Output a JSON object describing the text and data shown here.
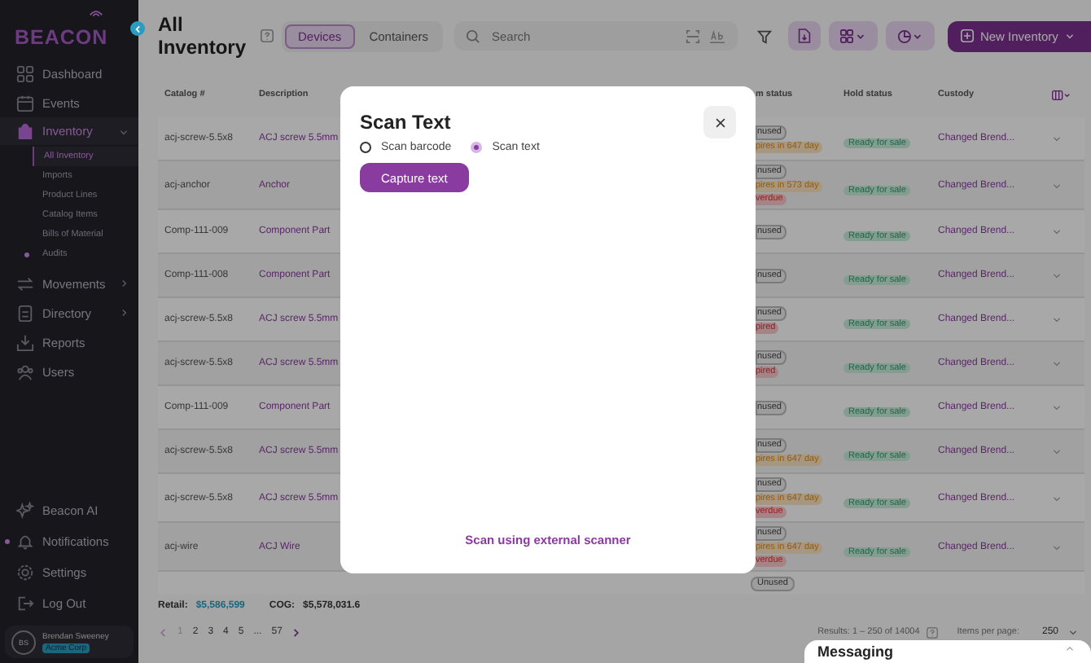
{
  "sidebar": {
    "logo": "BEACON",
    "nav": [
      {
        "label": "Dashboard",
        "kind": "link",
        "selected": false
      },
      {
        "label": "Events",
        "kind": "link",
        "selected": false
      },
      {
        "label": "Inventory",
        "kind": "group",
        "selected": true,
        "expanded": true,
        "children": [
          {
            "label": "All Inventory",
            "selected": true,
            "dot": false
          },
          {
            "label": "Imports",
            "selected": false,
            "dot": false
          },
          {
            "label": "Product Lines",
            "selected": false,
            "dot": false
          },
          {
            "label": "Catalog Items",
            "selected": false,
            "dot": false
          },
          {
            "label": "Bills of Material",
            "selected": false,
            "dot": false
          },
          {
            "label": "Audits",
            "selected": false,
            "dot": true
          }
        ]
      },
      {
        "label": "Movements",
        "kind": "group",
        "selected": false,
        "expanded": false
      },
      {
        "label": "Directory",
        "kind": "group",
        "selected": false,
        "expanded": false
      },
      {
        "label": "Reports",
        "kind": "link",
        "selected": false
      },
      {
        "label": "Users",
        "kind": "link",
        "selected": false
      }
    ],
    "bottom": [
      {
        "label": "Beacon AI",
        "dot": false
      },
      {
        "label": "Notifications",
        "dot": true
      },
      {
        "label": "Settings",
        "dot": false
      },
      {
        "label": "Log Out",
        "dot": false
      }
    ],
    "user": {
      "initials": "BS",
      "name": "Brendan Sweeney",
      "org": "Acme Corp"
    }
  },
  "header": {
    "title": "All Inventory",
    "tabs": [
      {
        "label": "Devices",
        "selected": true
      },
      {
        "label": "Containers",
        "selected": false
      }
    ],
    "search": {
      "placeholder": "Search"
    },
    "new_button": "New Inventory"
  },
  "table": {
    "columns": [
      "Catalog #",
      "Description",
      "m status",
      "Hold status",
      "Custody"
    ],
    "rows": [
      {
        "catalog": "acj-screw-5.5x8",
        "description": "ACJ screw 5.5mm",
        "tags": [
          {
            "kind": "unused",
            "text": "nused"
          },
          {
            "kind": "expires",
            "text": "pires in 647 day"
          }
        ],
        "hold": "Ready for sale",
        "custody": "Changed Brend..."
      },
      {
        "catalog": "acj-anchor",
        "description": "Anchor",
        "tags": [
          {
            "kind": "unused",
            "text": "nused"
          },
          {
            "kind": "expires",
            "text": "pires in 573 day"
          },
          {
            "kind": "overdue",
            "text": "verdue"
          }
        ],
        "hold": "Ready for sale",
        "custody": "Changed Brend..."
      },
      {
        "catalog": "Comp-111-009",
        "description": "Component Part",
        "tags": [
          {
            "kind": "unused",
            "text": "nused"
          }
        ],
        "hold": "Ready for sale",
        "custody": "Changed Brend..."
      },
      {
        "catalog": "Comp-111-008",
        "description": "Component Part",
        "tags": [
          {
            "kind": "unused",
            "text": "nused"
          }
        ],
        "hold": "Ready for sale",
        "custody": "Changed Brend..."
      },
      {
        "catalog": "acj-screw-5.5x8",
        "description": "ACJ screw 5.5mm",
        "tags": [
          {
            "kind": "unused",
            "text": "nused"
          },
          {
            "kind": "expired",
            "text": "pired"
          }
        ],
        "hold": "Ready for sale",
        "custody": "Changed Brend..."
      },
      {
        "catalog": "acj-screw-5.5x8",
        "description": "ACJ screw 5.5mm",
        "tags": [
          {
            "kind": "unused",
            "text": "nused"
          },
          {
            "kind": "expired",
            "text": "pired"
          }
        ],
        "hold": "Ready for sale",
        "custody": "Changed Brend..."
      },
      {
        "catalog": "Comp-111-009",
        "description": "Component Part",
        "tags": [
          {
            "kind": "unused",
            "text": "nused"
          }
        ],
        "hold": "Ready for sale",
        "custody": "Changed Brend..."
      },
      {
        "catalog": "acj-screw-5.5x8",
        "description": "ACJ screw 5.5mm",
        "tags": [
          {
            "kind": "unused",
            "text": "nused"
          },
          {
            "kind": "expires",
            "text": "pires in 647 day"
          }
        ],
        "hold": "Ready for sale",
        "custody": "Changed Brend..."
      },
      {
        "catalog": "acj-screw-5.5x8",
        "description": "ACJ screw 5.5mm",
        "tags": [
          {
            "kind": "unused",
            "text": "nused"
          },
          {
            "kind": "expires",
            "text": "pires in 647 day"
          },
          {
            "kind": "overdue",
            "text": "verdue"
          }
        ],
        "hold": "Ready for sale",
        "custody": "Changed Brend..."
      },
      {
        "catalog": "acj-wire",
        "description": "ACJ Wire",
        "tags": [
          {
            "kind": "unused",
            "text": "nused"
          },
          {
            "kind": "expires",
            "text": "pires in 647 day"
          },
          {
            "kind": "overdue",
            "text": "verdue"
          }
        ],
        "hold": "Ready for sale",
        "custody": "Changed Brend..."
      }
    ],
    "partial_row": {
      "tags": [
        {
          "kind": "unused",
          "text": "Unused"
        }
      ]
    }
  },
  "totals": {
    "retail_label": "Retail:",
    "retail": "$5,586,599",
    "cog_label": "COG:",
    "cog": "$5,578,031.6"
  },
  "pagination": {
    "pages": [
      {
        "label": "1",
        "selected": true
      },
      {
        "label": "2",
        "selected": false
      },
      {
        "label": "3",
        "selected": false
      },
      {
        "label": "4",
        "selected": false
      },
      {
        "label": "5",
        "selected": false
      },
      {
        "label": "...",
        "selected": false
      },
      {
        "label": "57",
        "selected": false
      }
    ],
    "results": "Results: 1 – 250 of 14004",
    "per_page_label": "Items per page:",
    "per_page": "250"
  },
  "messaging": {
    "title": "Messaging"
  },
  "modal": {
    "title": "Scan Text",
    "options": [
      {
        "label": "Scan barcode",
        "selected": false
      },
      {
        "label": "Scan text",
        "selected": true
      }
    ],
    "action": "Capture text",
    "link": "Scan using external scanner"
  }
}
